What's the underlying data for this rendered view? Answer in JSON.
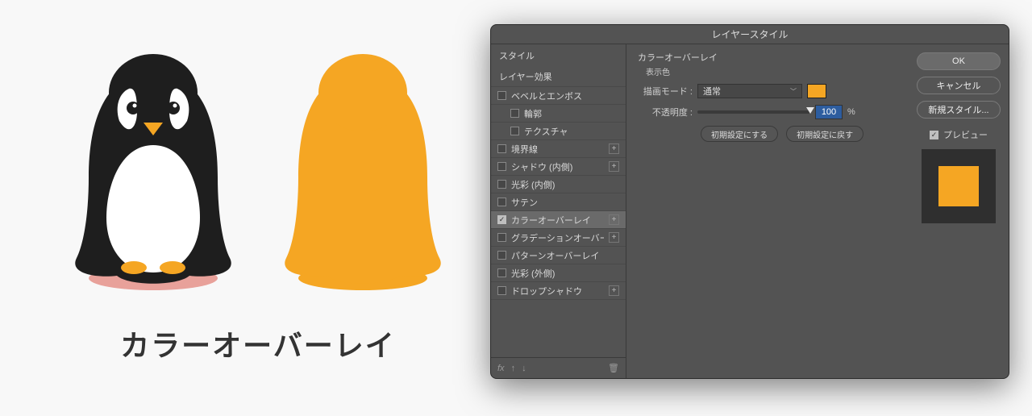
{
  "caption": "カラーオーバーレイ",
  "overlay_color": "#f5a623",
  "dialog": {
    "title": "レイヤースタイル",
    "sidebar": {
      "header": "スタイル",
      "subheader": "レイヤー効果",
      "items": [
        {
          "label": "ベベルとエンボス",
          "checked": false,
          "plus": false,
          "indent": false
        },
        {
          "label": "輪郭",
          "checked": false,
          "plus": false,
          "indent": true
        },
        {
          "label": "テクスチャ",
          "checked": false,
          "plus": false,
          "indent": true
        },
        {
          "label": "境界線",
          "checked": false,
          "plus": true,
          "indent": false
        },
        {
          "label": "シャドウ (内側)",
          "checked": false,
          "plus": true,
          "indent": false
        },
        {
          "label": "光彩 (内側)",
          "checked": false,
          "plus": false,
          "indent": false
        },
        {
          "label": "サテン",
          "checked": false,
          "plus": false,
          "indent": false
        },
        {
          "label": "カラーオーバーレイ",
          "checked": true,
          "plus": true,
          "indent": false,
          "selected": true
        },
        {
          "label": "グラデーションオーバーレイ",
          "checked": false,
          "plus": true,
          "indent": false
        },
        {
          "label": "パターンオーバーレイ",
          "checked": false,
          "plus": false,
          "indent": false
        },
        {
          "label": "光彩 (外側)",
          "checked": false,
          "plus": false,
          "indent": false
        },
        {
          "label": "ドロップシャドウ",
          "checked": false,
          "plus": true,
          "indent": false
        }
      ],
      "footer_fx": "fx"
    },
    "center": {
      "section": "カラーオーバーレイ",
      "fieldset": "表示色",
      "blend_label": "描画モード :",
      "blend_value": "通常",
      "opacity_label": "不透明度 :",
      "opacity_value": "100",
      "opacity_unit": "%",
      "btn_default": "初期設定にする",
      "btn_reset": "初期設定に戻す"
    },
    "right": {
      "ok": "OK",
      "cancel": "キャンセル",
      "newstyle": "新規スタイル...",
      "preview": "プレビュー"
    }
  }
}
